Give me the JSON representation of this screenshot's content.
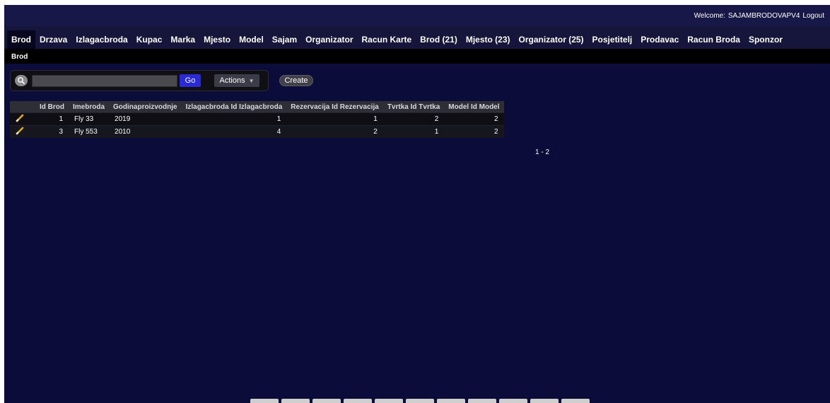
{
  "header": {
    "welcome_label": "Welcome:",
    "username": "SAJAMBRODOVAPV4",
    "logout_label": "Logout"
  },
  "nav": {
    "tabs": [
      {
        "label": "Brod",
        "active": true
      },
      {
        "label": "Drzava"
      },
      {
        "label": "Izlagacbroda"
      },
      {
        "label": "Kupac"
      },
      {
        "label": "Marka"
      },
      {
        "label": "Mjesto"
      },
      {
        "label": "Model"
      },
      {
        "label": "Sajam"
      },
      {
        "label": "Organizator"
      },
      {
        "label": "Racun Karte"
      },
      {
        "label": "Brod (21)"
      },
      {
        "label": "Mjesto (23)"
      },
      {
        "label": "Organizator (25)"
      },
      {
        "label": "Posjetitelj"
      },
      {
        "label": "Prodavac"
      },
      {
        "label": "Racun Broda"
      },
      {
        "label": "Sponzor"
      }
    ]
  },
  "breadcrumb": {
    "current": "Brod"
  },
  "toolbar": {
    "search_value": "",
    "go_label": "Go",
    "actions_label": "Actions",
    "create_label": "Create"
  },
  "table": {
    "columns": [
      "Id Brod",
      "Imebroda",
      "Godinaproizvodnje",
      "Izlagacbroda Id Izlagacbroda",
      "Rezervacija Id Rezervacija",
      "Tvrtka Id Tvrtka",
      "Model Id Model"
    ],
    "rows": [
      [
        "1",
        "Fly 33",
        "2019",
        "1",
        "1",
        "2",
        "2"
      ],
      [
        "3",
        "Fly 553",
        "2010",
        "4",
        "2",
        "1",
        "2"
      ]
    ]
  },
  "pagination": {
    "range": "1 - 2"
  }
}
